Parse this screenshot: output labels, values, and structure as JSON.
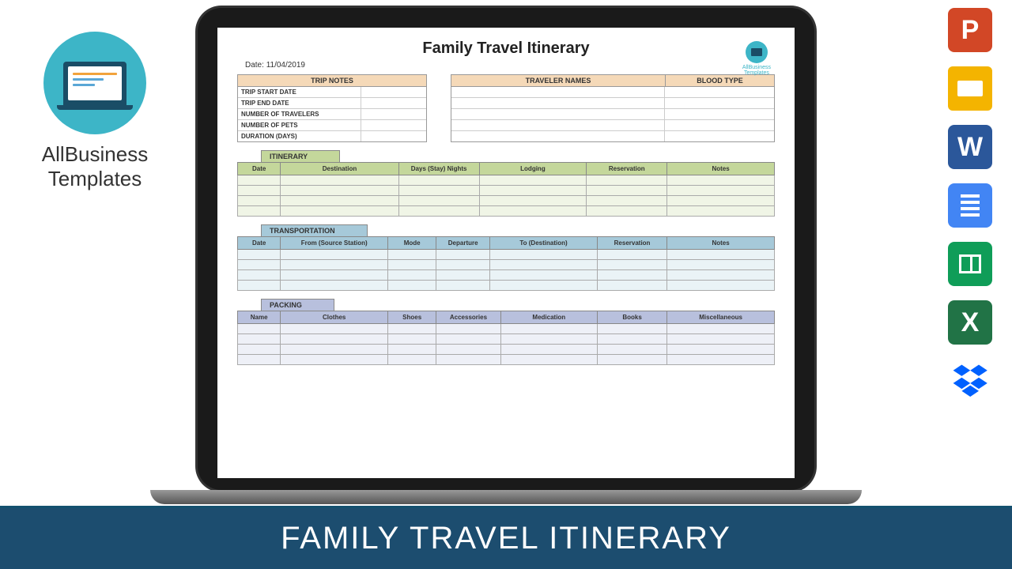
{
  "leftLogo": {
    "line1": "AllBusiness",
    "line2": "Templates"
  },
  "doc": {
    "title": "Family Travel Itinerary",
    "dateLabel": "Date:",
    "dateValue": "11/04/2019",
    "miniLogo": "AllBusiness\nTemplates",
    "tripNotes": {
      "header": "TRIP NOTES",
      "rows": [
        "TRIP START DATE",
        "TRIP END DATE",
        "NUMBER OF TRAVELERS",
        "NUMBER OF PETS",
        "DURATION (DAYS)"
      ]
    },
    "travelers": {
      "h1": "TRAVELER NAMES",
      "h2": "BLOOD TYPE"
    },
    "itinerary": {
      "title": "ITINERARY",
      "cols": [
        "Date",
        "Destination",
        "Days (Stay) Nights",
        "Lodging",
        "Reservation",
        "Notes"
      ]
    },
    "transport": {
      "title": "TRANSPORTATION",
      "cols": [
        "Date",
        "From (Source Station)",
        "Mode",
        "Departure",
        "To (Destination)",
        "Reservation",
        "Notes"
      ]
    },
    "packing": {
      "title": "PACKING",
      "cols": [
        "Name",
        "Clothes",
        "Shoes",
        "Accessories",
        "Medication",
        "Books",
        "Miscellaneous"
      ]
    }
  },
  "icons": {
    "ppt": "P",
    "word": "W",
    "excel": "X"
  },
  "banner": "FAMILY TRAVEL ITINERARY"
}
